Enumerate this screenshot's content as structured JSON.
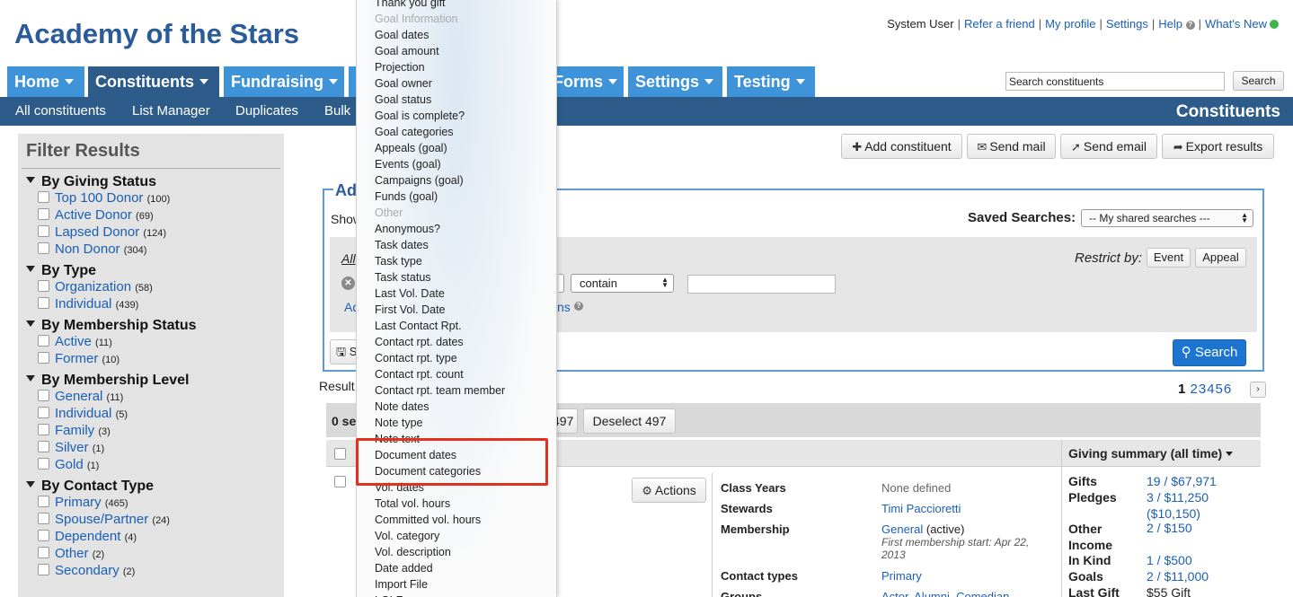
{
  "brand": "Academy of the Stars",
  "toplinks": {
    "user": "System User",
    "refer": "Refer a friend",
    "profile": "My profile",
    "settings": "Settings",
    "help": "Help",
    "whats_new": "What's New"
  },
  "search": {
    "value": "Search constituents",
    "button": "Search"
  },
  "mainnav": [
    "Home",
    "Constituents",
    "Fundraising",
    "",
    "Forms",
    "Settings",
    "Testing"
  ],
  "subnav": {
    "items": [
      "All constituents",
      "List Manager",
      "Duplicates",
      "Bulk"
    ],
    "title": "Constituents"
  },
  "filter": {
    "title": "Filter Results",
    "groups": [
      {
        "head": "By Giving Status",
        "items": [
          [
            "Top 100 Donor",
            "(100)"
          ],
          [
            "Active Donor",
            "(69)"
          ],
          [
            "Lapsed Donor",
            "(124)"
          ],
          [
            "Non Donor",
            "(304)"
          ]
        ]
      },
      {
        "head": "By Type",
        "items": [
          [
            "Organization",
            "(58)"
          ],
          [
            "Individual",
            "(439)"
          ]
        ]
      },
      {
        "head": "By Membership Status",
        "items": [
          [
            "Active",
            "(11)"
          ],
          [
            "Former",
            "(10)"
          ]
        ]
      },
      {
        "head": "By Membership Level",
        "items": [
          [
            "General",
            "(11)"
          ],
          [
            "Individual",
            "(5)"
          ],
          [
            "Family",
            "(3)"
          ],
          [
            "Silver",
            "(1)"
          ],
          [
            "Gold",
            "(1)"
          ]
        ]
      },
      {
        "head": "By Contact Type",
        "items": [
          [
            "Primary",
            "(465)"
          ],
          [
            "Spouse/Partner",
            "(24)"
          ],
          [
            "Dependent",
            "(4)"
          ],
          [
            "Other",
            "(2)"
          ],
          [
            "Secondary",
            "(2)"
          ]
        ]
      }
    ]
  },
  "actions": {
    "add": "Add constituent",
    "mail": "Send mail",
    "email": "Send email",
    "export": "Export results"
  },
  "advanced": {
    "title": "Adv",
    "show": "Show",
    "saved_label": "Saved Searches:",
    "saved_value": "-- My shared searches ---",
    "all": "All",
    "add": "Ad",
    "ns": "ns",
    "restrict": "Restrict by:",
    "event": "Event",
    "appeal": "Appeal",
    "contain": "contain",
    "search": "Search",
    "save": "S"
  },
  "results": {
    "label": "Result",
    "pager": {
      "current": "1",
      "pages": [
        "2",
        "3",
        "4",
        "5",
        "6"
      ]
    },
    "selected": "0 se",
    "select_num": "497",
    "deselect": "Deselect 497",
    "giving_header": "Giving summary (all time)",
    "actions": "Actions",
    "details": [
      {
        "label": "Class Years",
        "value": "None defined",
        "gray": true
      },
      {
        "label": "Stewards",
        "value": "Timi Paccioretti"
      },
      {
        "label": "Membership",
        "value": "General",
        "suffix": "(active)",
        "note": "First membership start: Apr 22, 2013"
      },
      {
        "label": "Contact types",
        "value": "Primary"
      },
      {
        "label": "Groups",
        "value": "Actor, Alumni, Comedian"
      }
    ],
    "giving": [
      {
        "label": "Gifts",
        "value": "19 / $67,971"
      },
      {
        "label": "Pledges",
        "value": "3 / $11,250",
        "value2": "($10,150)"
      },
      {
        "label": "Other Income",
        "value": "2 / $150"
      },
      {
        "label": "In Kind",
        "value": "1 / $500"
      },
      {
        "label": "Goals",
        "value": "2 / $11,000"
      },
      {
        "label": "Last Gift",
        "value": "$55 Gift"
      }
    ]
  },
  "menu": {
    "items": [
      {
        "t": "Thank you gift",
        "d": false
      },
      {
        "t": "Goal Information",
        "d": true
      },
      {
        "t": "Goal dates",
        "d": false
      },
      {
        "t": "Goal amount",
        "d": false
      },
      {
        "t": "Projection",
        "d": false
      },
      {
        "t": "Goal owner",
        "d": false
      },
      {
        "t": "Goal status",
        "d": false
      },
      {
        "t": "Goal is complete?",
        "d": false
      },
      {
        "t": "Goal categories",
        "d": false
      },
      {
        "t": "Appeals (goal)",
        "d": false
      },
      {
        "t": "Events (goal)",
        "d": false
      },
      {
        "t": "Campaigns (goal)",
        "d": false
      },
      {
        "t": "Funds (goal)",
        "d": false
      },
      {
        "t": "Other",
        "d": true
      },
      {
        "t": "Anonymous?",
        "d": false
      },
      {
        "t": "Task dates",
        "d": false
      },
      {
        "t": "Task type",
        "d": false
      },
      {
        "t": "Task status",
        "d": false
      },
      {
        "t": "Last Vol. Date",
        "d": false
      },
      {
        "t": "First Vol. Date",
        "d": false
      },
      {
        "t": "Last Contact Rpt.",
        "d": false
      },
      {
        "t": "Contact rpt. dates",
        "d": false
      },
      {
        "t": "Contact rpt. type",
        "d": false
      },
      {
        "t": "Contact rpt. count",
        "d": false
      },
      {
        "t": "Contact rpt. team member",
        "d": false
      },
      {
        "t": "Note dates",
        "d": false
      },
      {
        "t": "Note type",
        "d": false
      },
      {
        "t": "Note text",
        "d": false
      },
      {
        "t": "Document dates",
        "d": false
      },
      {
        "t": "Document categories",
        "d": false
      },
      {
        "t": "Vol. dates",
        "d": false
      },
      {
        "t": "Total vol. hours",
        "d": false
      },
      {
        "t": "Committed vol. hours",
        "d": false
      },
      {
        "t": "Vol. category",
        "d": false
      },
      {
        "t": "Vol. description",
        "d": false
      },
      {
        "t": "Date added",
        "d": false
      },
      {
        "t": "Import File",
        "d": false
      },
      {
        "t": "LGLF",
        "d": false
      }
    ]
  },
  "colors": {
    "brand": "#2a5b9a",
    "nav": "#3f94d9",
    "nav_active": "#2d5c8a",
    "highlight": "#e0321c"
  }
}
